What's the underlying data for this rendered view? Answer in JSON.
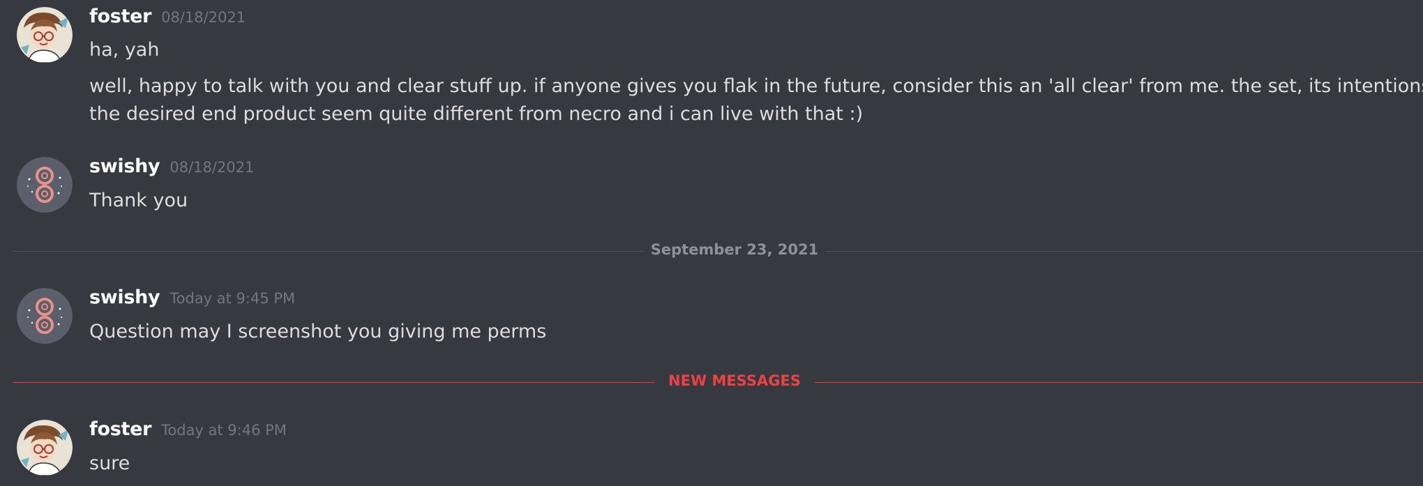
{
  "messages": [
    {
      "username": "foster",
      "timestamp": "08/18/2021",
      "lines": [
        "ha, yah",
        "well, happy to talk with you and clear stuff up. if anyone gives you flak in the future, consider this an 'all clear' from me. the set, its intentions, and",
        "the desired end product seem quite different from necro and i can live with that :)"
      ]
    },
    {
      "username": "swishy",
      "timestamp": "08/18/2021",
      "lines": [
        "Thank you"
      ]
    },
    {
      "username": "swishy",
      "timestamp": "Today at 9:45 PM",
      "lines": [
        "Question may I screenshot you giving me perms"
      ]
    },
    {
      "username": "foster",
      "timestamp": "Today at 9:46 PM",
      "lines": [
        "sure"
      ]
    }
  ],
  "dividers": {
    "date": "September 23, 2021",
    "new_messages": "NEW MESSAGES"
  },
  "colors": {
    "background": "#36393f",
    "username": "#ffffff",
    "timestamp": "#72767d",
    "message_text": "#dcddde",
    "new_messages_accent": "#ed4245",
    "date_divider": "#4f545c"
  }
}
